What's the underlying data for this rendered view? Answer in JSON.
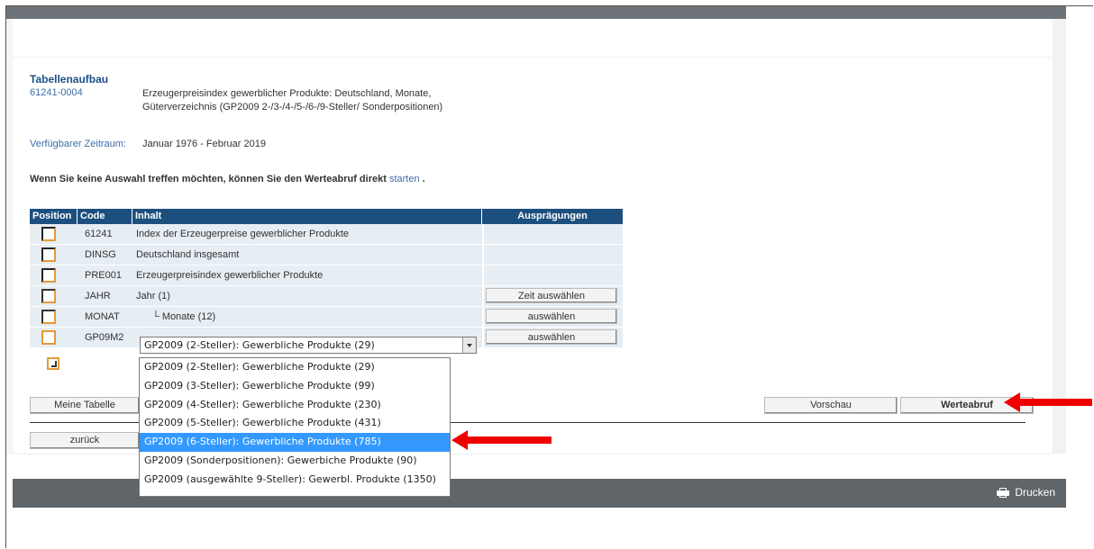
{
  "header": {
    "title": "Tabellenaufbau",
    "code": "61241-0004",
    "description": "Erzeugerpreisindex gewerblicher Produkte: Deutschland, Monate, Güterverzeichnis (GP2009 2-/3-/4-/5-/6-/9-Steller/ Sonderpositionen)",
    "zeit_label": "Verfügbarer Zeitraum:",
    "zeit_value": "Januar 1976 - Februar 2019"
  },
  "hint": {
    "text": "Wenn Sie keine Auswahl treffen möchten, können Sie den Werteabruf direkt",
    "link": "starten",
    "end": "."
  },
  "table": {
    "headers": [
      "Position",
      "Code",
      "Inhalt",
      "Ausprägungen"
    ],
    "rows": [
      {
        "code": "61241",
        "inhalt": "Index der Erzeugerpreise gewerblicher Produkte",
        "button": ""
      },
      {
        "code": "DINSG",
        "inhalt": "Deutschland insgesamt",
        "button": ""
      },
      {
        "code": "PRE001",
        "inhalt": "Erzeugerpreisindex gewerblicher Produkte",
        "button": ""
      },
      {
        "code": "JAHR",
        "inhalt": "Jahr (1)",
        "button": "Zeit auswählen"
      },
      {
        "code": "MONAT",
        "inhalt": "└ Monate (12)",
        "button": "auswählen"
      },
      {
        "code": "GP09M2",
        "inhalt": "",
        "button": "auswählen"
      }
    ]
  },
  "select": {
    "current": "GP2009 (2-Steller): Gewerbliche Produkte (29)",
    "options": [
      "GP2009 (2-Steller): Gewerbliche Produkte (29)",
      "GP2009 (3-Steller): Gewerbliche Produkte (99)",
      "GP2009 (4-Steller): Gewerbliche Produkte (230)",
      "GP2009 (5-Steller): Gewerbliche Produkte (431)",
      "GP2009 (6-Steller): Gewerbliche Produkte (785)",
      "GP2009 (Sonderpositionen): Gewerbiche Produkte (90)",
      "GP2009 (ausgewählte 9-Steller): Gewerbl. Produkte (1350)"
    ],
    "highlighted_index": 4
  },
  "buttons": {
    "meine_tabelle": "Meine Tabelle",
    "vorschau": "Vorschau",
    "werteabruf": "Werteabruf",
    "zurueck": "zurück"
  },
  "footer": {
    "print": "Drucken"
  },
  "colors": {
    "header_blue": "#1d4f7e",
    "link_blue": "#3d6ea6",
    "highlight": "#3399ff",
    "arrow_red": "#e00000"
  }
}
